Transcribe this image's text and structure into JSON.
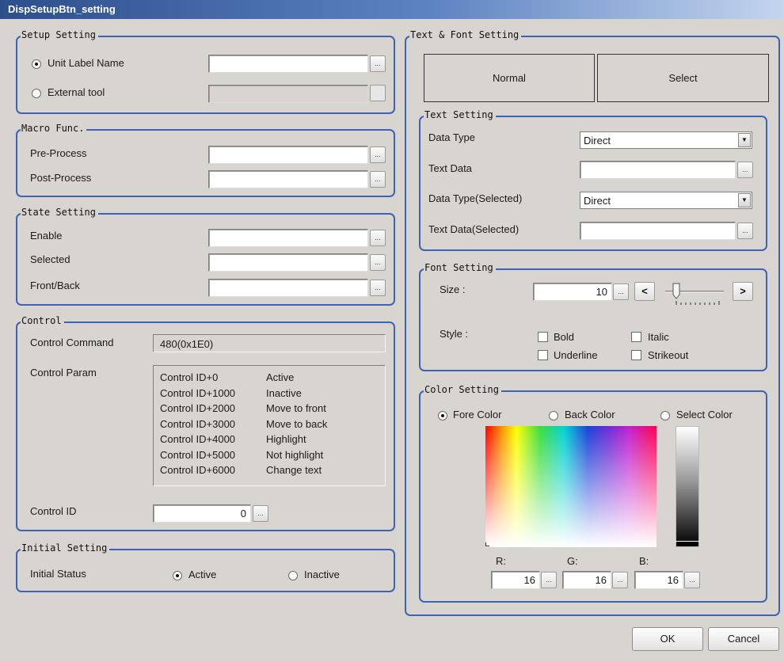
{
  "window": {
    "title": "DispSetupBtn_setting"
  },
  "setup": {
    "legend": "Setup Setting",
    "unit_label": "Unit Label Name",
    "external_tool": "External tool",
    "dots": "..."
  },
  "macro": {
    "legend": "Macro Func.",
    "pre": "Pre-Process",
    "post": "Post-Process"
  },
  "state": {
    "legend": "State Setting",
    "enable": "Enable",
    "selected": "Selected",
    "front_back": "Front/Back"
  },
  "control": {
    "legend": "Control",
    "command_label": "Control Command",
    "command_value": "480(0x1E0)",
    "param_label": "Control Param",
    "params": [
      {
        "id": "Control ID+0",
        "desc": "Active"
      },
      {
        "id": "Control ID+1000",
        "desc": "Inactive"
      },
      {
        "id": "Control ID+2000",
        "desc": "Move to front"
      },
      {
        "id": "Control ID+3000",
        "desc": "Move to back"
      },
      {
        "id": "Control ID+4000",
        "desc": "Highlight"
      },
      {
        "id": "Control ID+5000",
        "desc": "Not highlight"
      },
      {
        "id": "Control ID+6000",
        "desc": "Change text"
      }
    ],
    "id_label": "Control ID",
    "id_value": "0"
  },
  "initial": {
    "legend": "Initial Setting",
    "status_label": "Initial Status",
    "active": "Active",
    "inactive": "Inactive"
  },
  "text_font": {
    "legend": "Text & Font Setting",
    "normal": "Normal",
    "select": "Select"
  },
  "text_setting": {
    "legend": "Text Setting",
    "data_type": "Data Type",
    "data_type_value": "Direct",
    "text_data": "Text Data",
    "data_type_sel": "Data Type(Selected)",
    "data_type_sel_value": "Direct",
    "text_data_sel": "Text Data(Selected)"
  },
  "font_setting": {
    "legend": "Font Setting",
    "size_label": "Size :",
    "size_value": "10",
    "dec": "<",
    "inc": ">",
    "style_label": "Style :",
    "bold": "Bold",
    "italic": "Italic",
    "underline": "Underline",
    "strikeout": "Strikeout"
  },
  "color_setting": {
    "legend": "Color Setting",
    "fore": "Fore Color",
    "back": "Back Color",
    "select": "Select Color",
    "r_label": "R:",
    "g_label": "G:",
    "b_label": "B:",
    "r": "16",
    "g": "16",
    "b": "16"
  },
  "footer": {
    "ok": "OK",
    "cancel": "Cancel"
  }
}
